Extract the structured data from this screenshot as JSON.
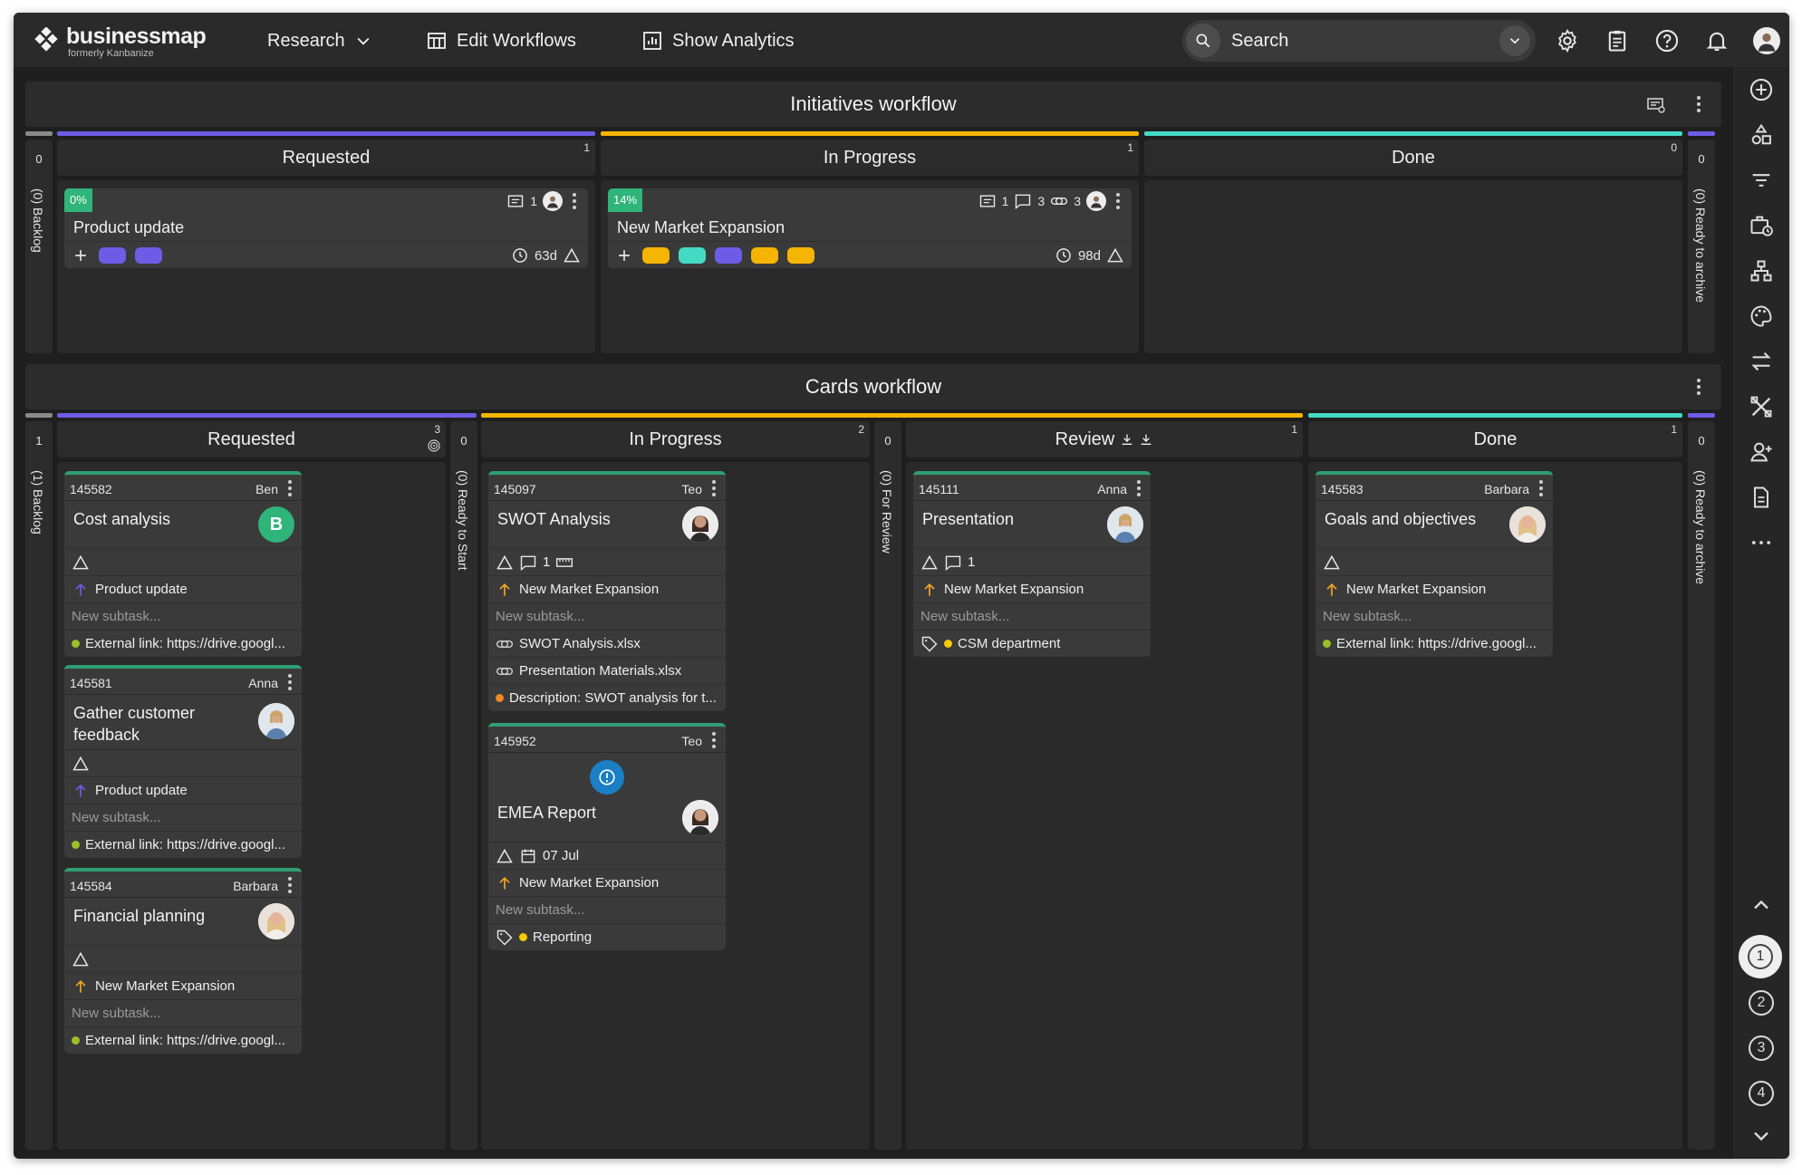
{
  "app": {
    "brand": "businessmap",
    "brand_sub": "formerly Kanbanize",
    "colors": {
      "accent_green": "#2fb47a",
      "requested": "#6e5ce6",
      "in_progress": "#f5b400",
      "done": "#44d9c4",
      "card_top": "#2f9e73"
    }
  },
  "nav": {
    "workspace": "Research",
    "edit_workflows": "Edit Workflows",
    "show_analytics": "Show Analytics",
    "search_placeholder": "Search"
  },
  "topbar_icons": [
    "settings-icon",
    "clipboard-icon",
    "help-icon",
    "bell-icon",
    "user-avatar"
  ],
  "initiatives": {
    "title": "Initiatives workflow",
    "backlog": {
      "count": "0",
      "label": "(0) Backlog"
    },
    "archive": {
      "count": "0",
      "label": "(0) Ready to archive"
    },
    "columns": [
      {
        "name": "Requested",
        "count": "1"
      },
      {
        "name": "In Progress",
        "count": "1"
      },
      {
        "name": "Done",
        "count": "0"
      }
    ],
    "cards": [
      {
        "progress": "0%",
        "comments": "1",
        "title": "Product update",
        "time": "63d",
        "labels": [
          "#6e5ce6",
          "#6e5ce6"
        ]
      },
      {
        "progress": "14%",
        "comments": "1",
        "chats": "3",
        "links": "3",
        "title": "New Market Expansion",
        "time": "98d",
        "labels": [
          "#f5b400",
          "#44d9c4",
          "#6e5ce6",
          "#f5b400",
          "#f5b400"
        ]
      }
    ]
  },
  "cards_wf": {
    "title": "Cards workflow",
    "backlog": {
      "count": "1",
      "label": "(1) Backlog"
    },
    "ready_to_start": {
      "count": "0",
      "label": "(0) Ready to Start"
    },
    "for_review": {
      "count": "0",
      "label": "(0) For Review"
    },
    "archive": {
      "count": "0",
      "label": "(0) Ready to archive"
    },
    "columns": [
      {
        "name": "Requested",
        "count": "3"
      },
      {
        "name": "In Progress",
        "count": "2"
      },
      {
        "name": "Review",
        "count": "1"
      },
      {
        "name": "Done",
        "count": "1"
      }
    ],
    "subtask_placeholder": "New subtask...",
    "cards": {
      "c145582": {
        "id": "145582",
        "owner": "Ben",
        "title": "Cost analysis",
        "avatar_letter": "B",
        "parent": "Product update",
        "link": "External link: https://drive.googl..."
      },
      "c145581": {
        "id": "145581",
        "owner": "Anna",
        "title": "Gather customer feedback",
        "parent": "Product update",
        "link": "External link: https://drive.googl..."
      },
      "c145584": {
        "id": "145584",
        "owner": "Barbara",
        "title": "Financial planning",
        "parent": "New Market Expansion",
        "link": "External link: https://drive.googl..."
      },
      "c145097": {
        "id": "145097",
        "owner": "Teo",
        "title": "SWOT Analysis",
        "comments": "1",
        "parent": "New Market Expansion",
        "attachments": [
          "SWOT Analysis.xlsx",
          "Presentation Materials.xlsx"
        ],
        "description": "Description: SWOT analysis for t..."
      },
      "c145952": {
        "id": "145952",
        "owner": "Teo",
        "title": "EMEA Report",
        "deadline": "07 Jul",
        "parent": "New Market Expansion",
        "tag": "Reporting"
      },
      "c145111": {
        "id": "145111",
        "owner": "Anna",
        "title": "Presentation",
        "comments": "1",
        "parent": "New Market Expansion",
        "tag": "CSM department"
      },
      "c145583": {
        "id": "145583",
        "owner": "Barbara",
        "title": "Goals and objectives",
        "parent": "New Market Expansion",
        "link": "External link: https://drive.googl..."
      }
    }
  },
  "rail": {
    "levels": [
      "1",
      "2",
      "3",
      "4"
    ]
  }
}
